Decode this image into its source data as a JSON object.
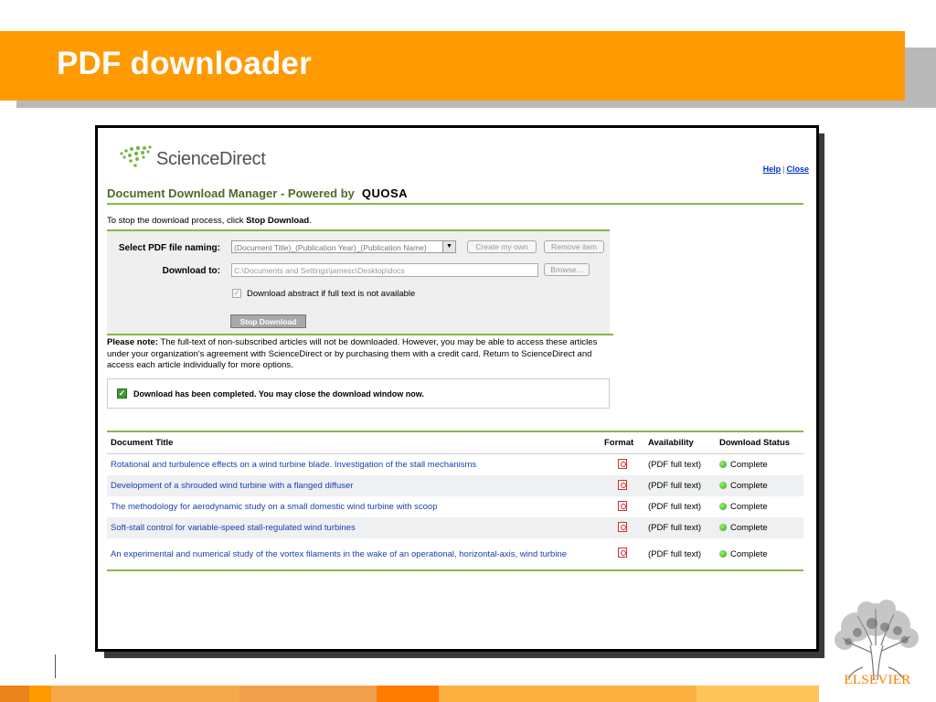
{
  "slide": {
    "title": "PDF downloader",
    "brand": "ELSEVIER",
    "footer_colors": [
      "#e8841a",
      "#ff9a00",
      "#f6a94a",
      "#f0a04a",
      "#ff7a00",
      "#fcb040",
      "#ffc45a"
    ]
  },
  "app": {
    "brand": "ScienceDirect",
    "links": {
      "help": "Help",
      "separator": "|",
      "close": "Close"
    },
    "title": "Document Download Manager - Powered by",
    "powered_by": "QUOSA",
    "instruction_prefix": "To stop the download process, click ",
    "instruction_action": "Stop Download",
    "instruction_suffix": ".",
    "form": {
      "naming_label": "Select PDF file naming:",
      "naming_value": "(Document Title)_(Publication Year)_(Publication Name)",
      "create_label": "Create my own",
      "remove_label": "Remove item",
      "download_label": "Download to:",
      "download_path": "C:\\Documents and Settings\\jamesc\\Desktop\\docs",
      "browse_label": "Browse...",
      "checkbox_label": "Download abstract if full text is not available",
      "checkbox_checked": true,
      "stop_label": "Stop Download"
    },
    "note_label": "Please note:",
    "note_text": " The full-text of non-subscribed articles will not be downloaded. However, you may be able to access these articles under your organization's agreement with ScienceDirect or by purchasing them with a credit card. Return to ScienceDirect and access each article individually for more options.",
    "complete_message": "Download has been completed. You may close the download window now.",
    "table": {
      "headers": [
        "Document Title",
        "Format",
        "Availability",
        "Download Status"
      ],
      "rows": [
        {
          "title": "Rotational and turbulence effects on a wind turbine blade. Investigation of the stall mechanisms",
          "availability": "(PDF full text)",
          "status": "Complete"
        },
        {
          "title": "Development of a shrouded wind turbine with a flanged diffuser",
          "availability": "(PDF full text)",
          "status": "Complete"
        },
        {
          "title": "The methodology for aerodynamic study on a small domestic wind turbine with scoop",
          "availability": "(PDF full text)",
          "status": "Complete"
        },
        {
          "title": "Soft-stall control for variable-speed stall-regulated wind turbines",
          "availability": "(PDF full text)",
          "status": "Complete"
        },
        {
          "title": "An experimental and numerical study of the vortex filaments in the wake of an operational, horizontal-axis, wind turbine",
          "availability": "(PDF full text)",
          "status": "Complete"
        }
      ]
    }
  }
}
